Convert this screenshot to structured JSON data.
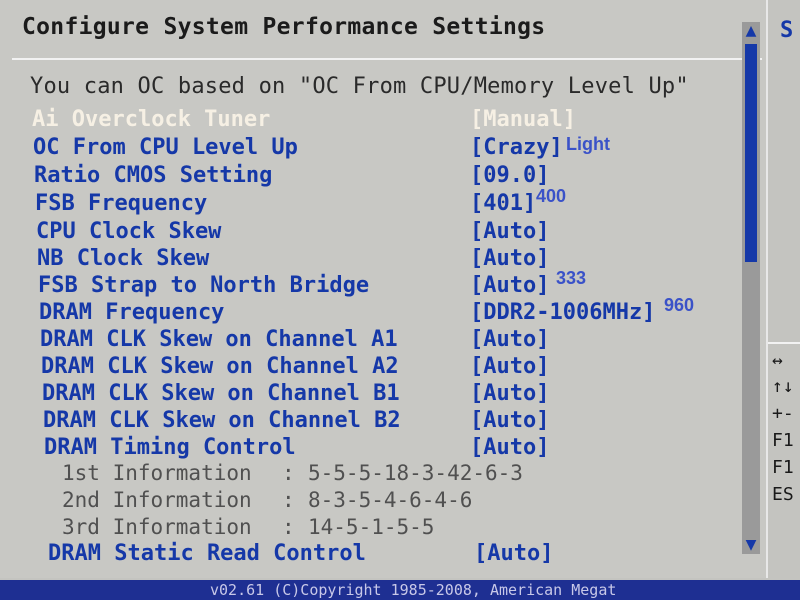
{
  "title": "Configure System Performance Settings",
  "note": "You can OC based on \"OC From CPU/Memory Level Up\"",
  "settings": [
    {
      "label": "Ai Overclock Tuner",
      "value": "[Manual]",
      "annotation": ""
    },
    {
      "label": "OC From CPU Level Up",
      "value": "[Crazy]",
      "annotation": "Light"
    },
    {
      "label": "Ratio CMOS Setting",
      "value": "[09.0]",
      "annotation": ""
    },
    {
      "label": "FSB Frequency",
      "value": "[401]",
      "annotation": "400"
    },
    {
      "label": "CPU Clock Skew",
      "value": "[Auto]",
      "annotation": ""
    },
    {
      "label": "NB Clock Skew",
      "value": "[Auto]",
      "annotation": ""
    },
    {
      "label": "FSB Strap to North Bridge",
      "value": "[Auto]",
      "annotation": "333"
    },
    {
      "label": "DRAM Frequency",
      "value": "[DDR2-1006MHz]",
      "annotation": "960"
    },
    {
      "label": "DRAM CLK Skew on Channel A1",
      "value": "[Auto]",
      "annotation": ""
    },
    {
      "label": "DRAM CLK Skew on Channel A2",
      "value": "[Auto]",
      "annotation": ""
    },
    {
      "label": "DRAM CLK Skew on Channel B1",
      "value": "[Auto]",
      "annotation": ""
    },
    {
      "label": "DRAM CLK Skew on Channel B2",
      "value": "[Auto]",
      "annotation": ""
    },
    {
      "label": "DRAM Timing Control",
      "value": "[Auto]",
      "annotation": ""
    }
  ],
  "timing_info": [
    {
      "label": "1st Information",
      "sep": ":",
      "value": "5-5-5-18-3-42-6-3"
    },
    {
      "label": "2nd Information",
      "sep": ":",
      "value": "8-3-5-4-6-4-6"
    },
    {
      "label": "3rd Information",
      "sep": ":",
      "value": "14-5-1-5-5"
    }
  ],
  "last_setting": {
    "label": "DRAM Static Read Control",
    "value": "[Auto]"
  },
  "scrollbar": {
    "up_arrow": "▲",
    "down_arrow": "▼"
  },
  "side_panel": {
    "select_fragment": "S",
    "keys": [
      "↔",
      "↑↓",
      "+-",
      "F1",
      "F1",
      "ES"
    ]
  },
  "footer": "v02.61 (C)Copyright 1985-2008, American Megat",
  "colors": {
    "background": "#c8c8c4",
    "setting_text": "#1538a8",
    "highlight_text": "#f6f0e4",
    "annotation": "#3a52c8",
    "footer_bg": "#1e2f92"
  },
  "icons": {
    "scroll_up": "triangle-up-icon",
    "scroll_down": "triangle-down-icon"
  }
}
